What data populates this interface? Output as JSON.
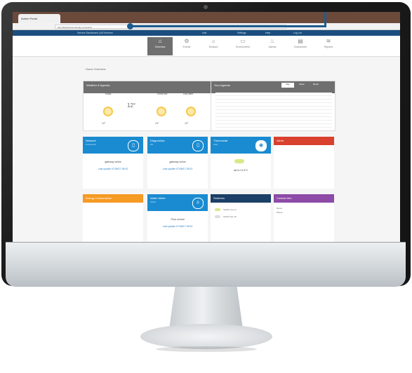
{
  "browser": {
    "tab_title": "Admin Portal",
    "url": "http://dashboard.example.com/portal"
  },
  "topnav": {
    "left": "Service Dashboard | All Services",
    "links": [
      "Unit",
      "Settings",
      "Help",
      "Log out"
    ]
  },
  "toolbar": {
    "items": [
      {
        "label": "Overview",
        "icon": "home-icon",
        "glyph": "⌂"
      },
      {
        "label": "Events",
        "icon": "gear-icon",
        "glyph": "⚙"
      },
      {
        "label": "Sensors",
        "icon": "bulb-icon",
        "glyph": "☼"
      },
      {
        "label": "Environment",
        "icon": "folder-icon",
        "glyph": "▭"
      },
      {
        "label": "Alarms",
        "icon": "bell-icon",
        "glyph": "♨"
      },
      {
        "label": "Documents",
        "icon": "document-icon",
        "glyph": "▤"
      },
      {
        "label": "Reports",
        "icon": "chart-icon",
        "glyph": "≋"
      }
    ]
  },
  "breadcrumb": "Home Overview",
  "weather": {
    "title": "Weather & Agenda",
    "days": [
      {
        "label": "Today",
        "temp": "12°"
      },
      {
        "label": "Tomorrow",
        "temp": "14°"
      },
      {
        "label": "Day after",
        "temp": "13°"
      }
    ],
    "current_temp": "12°"
  },
  "table": {
    "title": "Your Agenda",
    "tabs": [
      "Day",
      "Week",
      "Month"
    ]
  },
  "tiles": [
    {
      "title": "Network",
      "sub": "Connected",
      "color": "#1a8bd1",
      "line1": "gateway online",
      "line2": "Last update 07/08/17 08:32"
    },
    {
      "title": "Diagnostics",
      "sub": "OK",
      "color": "#1a8bd1",
      "line1": "gateway online",
      "line2": "Last update 07/08/17 08:32"
    },
    {
      "title": "Thermostat",
      "sub": "Auto",
      "color": "#1a8bd1",
      "line1": "set to 21.5°C",
      "line2": ""
    },
    {
      "title": "Alerts",
      "sub": "",
      "color": "#d9412f",
      "line1": "",
      "line2": ""
    },
    {
      "title": "Energy Consumption",
      "sub": "",
      "color": "#f59a23",
      "line1": "",
      "line2": ""
    },
    {
      "title": "Water Meter",
      "sub": "Active",
      "color": "#1a8bd1",
      "line1": "Flow normal",
      "line2": "Last update 07/08/17 08:32"
    },
    {
      "title": "Switches",
      "sub": "",
      "color": "#1b3f66",
      "line1": "Switch one on",
      "line2": "Switch two off"
    },
    {
      "title": "Contact Info",
      "sub": "",
      "color": "#8d4aa6",
      "line1": "Name",
      "line2": "Phone"
    }
  ]
}
